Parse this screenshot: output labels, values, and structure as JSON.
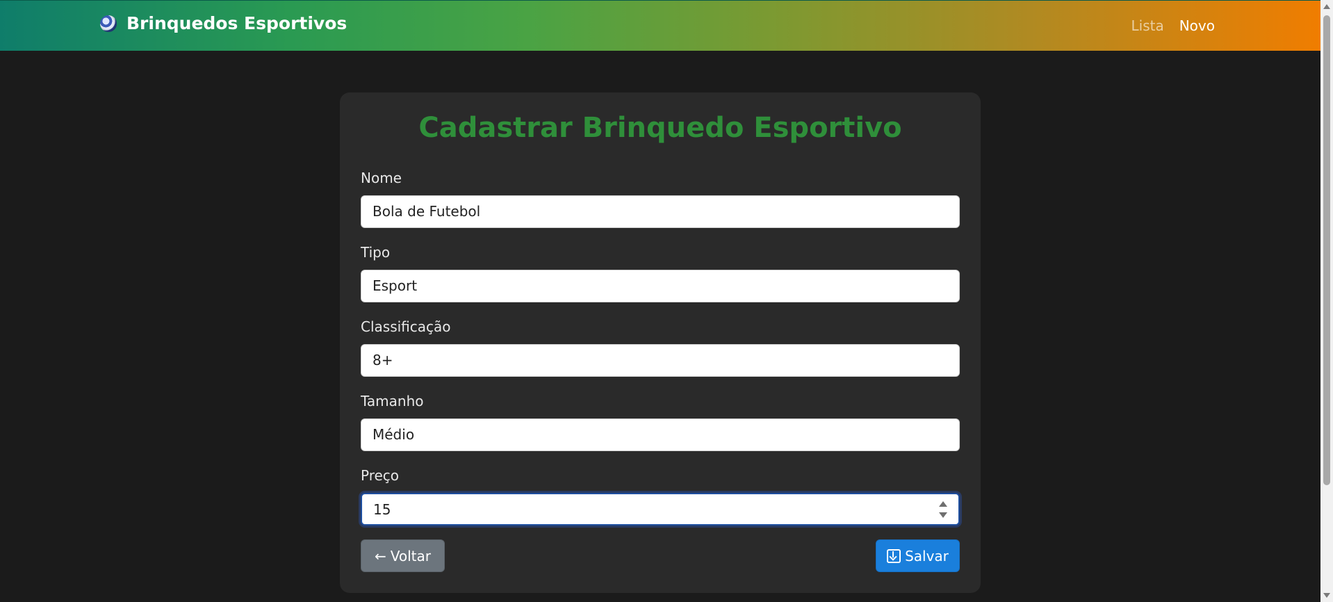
{
  "navbar": {
    "brand": "Brinquedos Esportivos",
    "brand_icon": "soccer-ball-icon",
    "links": [
      {
        "label": "Lista"
      },
      {
        "label": "Novo"
      }
    ]
  },
  "form": {
    "title": "Cadastrar Brinquedo Esportivo",
    "fields": {
      "nome": {
        "label": "Nome",
        "value": "Bola de Futebol"
      },
      "tipo": {
        "label": "Tipo",
        "value": "Esport"
      },
      "classificacao": {
        "label": "Classificação",
        "value": "8+"
      },
      "tamanho": {
        "label": "Tamanho",
        "value": "Médio"
      },
      "preco": {
        "label": "Preço",
        "value": "15"
      }
    },
    "buttons": {
      "back": {
        "arrow": "←",
        "label": "Voltar"
      },
      "save": {
        "label": "Salvar",
        "icon": "download-icon"
      }
    }
  },
  "colors": {
    "title": "#2f8f3a",
    "save_button": "#1a7fdc",
    "back_button": "#6c757d",
    "background": "#1b1b1b",
    "card": "#2a2a2a"
  }
}
